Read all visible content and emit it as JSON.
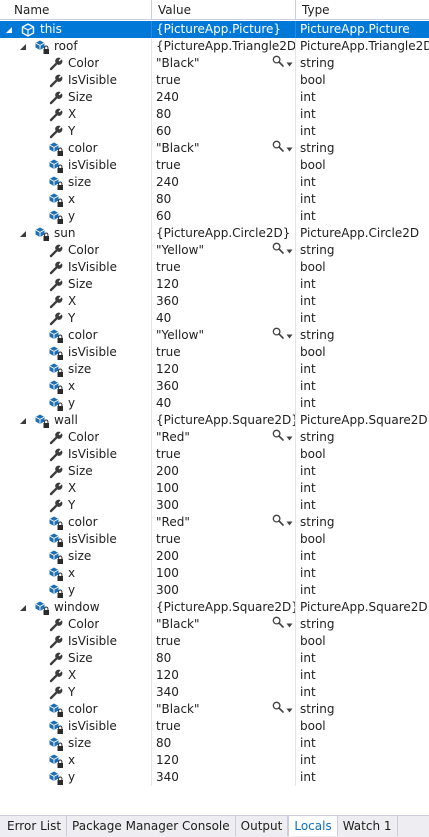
{
  "columns": {
    "name": "Name",
    "value": "Value",
    "type": "Type"
  },
  "colors": {
    "selection": "#0078d7",
    "object_icon": "#1f6fb2",
    "wrench_icon": "#3c3c3c"
  },
  "rows": [
    {
      "level": 0,
      "expand": "open",
      "icon": "object-icon",
      "name": "this",
      "value": "{PictureApp.Picture}",
      "type": "PictureApp.Picture",
      "selected": true
    },
    {
      "level": 1,
      "expand": "open",
      "icon": "field-locked-icon",
      "name": "roof",
      "value": "{PictureApp.Triangle2D}",
      "type": "PictureApp.Triangle2D"
    },
    {
      "level": 2,
      "expand": "none",
      "icon": "wrench-icon",
      "name": "Color",
      "value": "\"Black\"",
      "type": "string",
      "viz": true
    },
    {
      "level": 2,
      "expand": "none",
      "icon": "wrench-icon",
      "name": "IsVisible",
      "value": "true",
      "type": "bool"
    },
    {
      "level": 2,
      "expand": "none",
      "icon": "wrench-icon",
      "name": "Size",
      "value": "240",
      "type": "int"
    },
    {
      "level": 2,
      "expand": "none",
      "icon": "wrench-icon",
      "name": "X",
      "value": "80",
      "type": "int"
    },
    {
      "level": 2,
      "expand": "none",
      "icon": "wrench-icon",
      "name": "Y",
      "value": "60",
      "type": "int"
    },
    {
      "level": 2,
      "expand": "none",
      "icon": "field-locked-icon",
      "name": "color",
      "value": "\"Black\"",
      "type": "string",
      "viz": true
    },
    {
      "level": 2,
      "expand": "none",
      "icon": "field-locked-icon",
      "name": "isVisible",
      "value": "true",
      "type": "bool"
    },
    {
      "level": 2,
      "expand": "none",
      "icon": "field-locked-icon",
      "name": "size",
      "value": "240",
      "type": "int"
    },
    {
      "level": 2,
      "expand": "none",
      "icon": "field-locked-icon",
      "name": "x",
      "value": "80",
      "type": "int"
    },
    {
      "level": 2,
      "expand": "none",
      "icon": "field-locked-icon",
      "name": "y",
      "value": "60",
      "type": "int"
    },
    {
      "level": 1,
      "expand": "open",
      "icon": "field-locked-icon",
      "name": "sun",
      "value": "{PictureApp.Circle2D}",
      "type": "PictureApp.Circle2D"
    },
    {
      "level": 2,
      "expand": "none",
      "icon": "wrench-icon",
      "name": "Color",
      "value": "\"Yellow\"",
      "type": "string",
      "viz": true
    },
    {
      "level": 2,
      "expand": "none",
      "icon": "wrench-icon",
      "name": "IsVisible",
      "value": "true",
      "type": "bool"
    },
    {
      "level": 2,
      "expand": "none",
      "icon": "wrench-icon",
      "name": "Size",
      "value": "120",
      "type": "int"
    },
    {
      "level": 2,
      "expand": "none",
      "icon": "wrench-icon",
      "name": "X",
      "value": "360",
      "type": "int"
    },
    {
      "level": 2,
      "expand": "none",
      "icon": "wrench-icon",
      "name": "Y",
      "value": "40",
      "type": "int"
    },
    {
      "level": 2,
      "expand": "none",
      "icon": "field-locked-icon",
      "name": "color",
      "value": "\"Yellow\"",
      "type": "string",
      "viz": true
    },
    {
      "level": 2,
      "expand": "none",
      "icon": "field-locked-icon",
      "name": "isVisible",
      "value": "true",
      "type": "bool"
    },
    {
      "level": 2,
      "expand": "none",
      "icon": "field-locked-icon",
      "name": "size",
      "value": "120",
      "type": "int"
    },
    {
      "level": 2,
      "expand": "none",
      "icon": "field-locked-icon",
      "name": "x",
      "value": "360",
      "type": "int"
    },
    {
      "level": 2,
      "expand": "none",
      "icon": "field-locked-icon",
      "name": "y",
      "value": "40",
      "type": "int"
    },
    {
      "level": 1,
      "expand": "open",
      "icon": "field-locked-icon",
      "name": "wall",
      "value": "{PictureApp.Square2D}",
      "type": "PictureApp.Square2D"
    },
    {
      "level": 2,
      "expand": "none",
      "icon": "wrench-icon",
      "name": "Color",
      "value": "\"Red\"",
      "type": "string",
      "viz": true
    },
    {
      "level": 2,
      "expand": "none",
      "icon": "wrench-icon",
      "name": "IsVisible",
      "value": "true",
      "type": "bool"
    },
    {
      "level": 2,
      "expand": "none",
      "icon": "wrench-icon",
      "name": "Size",
      "value": "200",
      "type": "int"
    },
    {
      "level": 2,
      "expand": "none",
      "icon": "wrench-icon",
      "name": "X",
      "value": "100",
      "type": "int"
    },
    {
      "level": 2,
      "expand": "none",
      "icon": "wrench-icon",
      "name": "Y",
      "value": "300",
      "type": "int"
    },
    {
      "level": 2,
      "expand": "none",
      "icon": "field-locked-icon",
      "name": "color",
      "value": "\"Red\"",
      "type": "string",
      "viz": true
    },
    {
      "level": 2,
      "expand": "none",
      "icon": "field-locked-icon",
      "name": "isVisible",
      "value": "true",
      "type": "bool"
    },
    {
      "level": 2,
      "expand": "none",
      "icon": "field-locked-icon",
      "name": "size",
      "value": "200",
      "type": "int"
    },
    {
      "level": 2,
      "expand": "none",
      "icon": "field-locked-icon",
      "name": "x",
      "value": "100",
      "type": "int"
    },
    {
      "level": 2,
      "expand": "none",
      "icon": "field-locked-icon",
      "name": "y",
      "value": "300",
      "type": "int"
    },
    {
      "level": 1,
      "expand": "open",
      "icon": "field-locked-icon",
      "name": "window",
      "value": "{PictureApp.Square2D}",
      "type": "PictureApp.Square2D"
    },
    {
      "level": 2,
      "expand": "none",
      "icon": "wrench-icon",
      "name": "Color",
      "value": "\"Black\"",
      "type": "string",
      "viz": true
    },
    {
      "level": 2,
      "expand": "none",
      "icon": "wrench-icon",
      "name": "IsVisible",
      "value": "true",
      "type": "bool"
    },
    {
      "level": 2,
      "expand": "none",
      "icon": "wrench-icon",
      "name": "Size",
      "value": "80",
      "type": "int"
    },
    {
      "level": 2,
      "expand": "none",
      "icon": "wrench-icon",
      "name": "X",
      "value": "120",
      "type": "int"
    },
    {
      "level": 2,
      "expand": "none",
      "icon": "wrench-icon",
      "name": "Y",
      "value": "340",
      "type": "int"
    },
    {
      "level": 2,
      "expand": "none",
      "icon": "field-locked-icon",
      "name": "color",
      "value": "\"Black\"",
      "type": "string",
      "viz": true
    },
    {
      "level": 2,
      "expand": "none",
      "icon": "field-locked-icon",
      "name": "isVisible",
      "value": "true",
      "type": "bool"
    },
    {
      "level": 2,
      "expand": "none",
      "icon": "field-locked-icon",
      "name": "size",
      "value": "80",
      "type": "int"
    },
    {
      "level": 2,
      "expand": "none",
      "icon": "field-locked-icon",
      "name": "x",
      "value": "120",
      "type": "int"
    },
    {
      "level": 2,
      "expand": "none",
      "icon": "field-locked-icon",
      "name": "y",
      "value": "340",
      "type": "int"
    }
  ],
  "tabs": [
    {
      "label": "Error List",
      "active": false
    },
    {
      "label": "Package Manager Console",
      "active": false
    },
    {
      "label": "Output",
      "active": false
    },
    {
      "label": "Locals",
      "active": true
    },
    {
      "label": "Watch 1",
      "active": false
    }
  ]
}
